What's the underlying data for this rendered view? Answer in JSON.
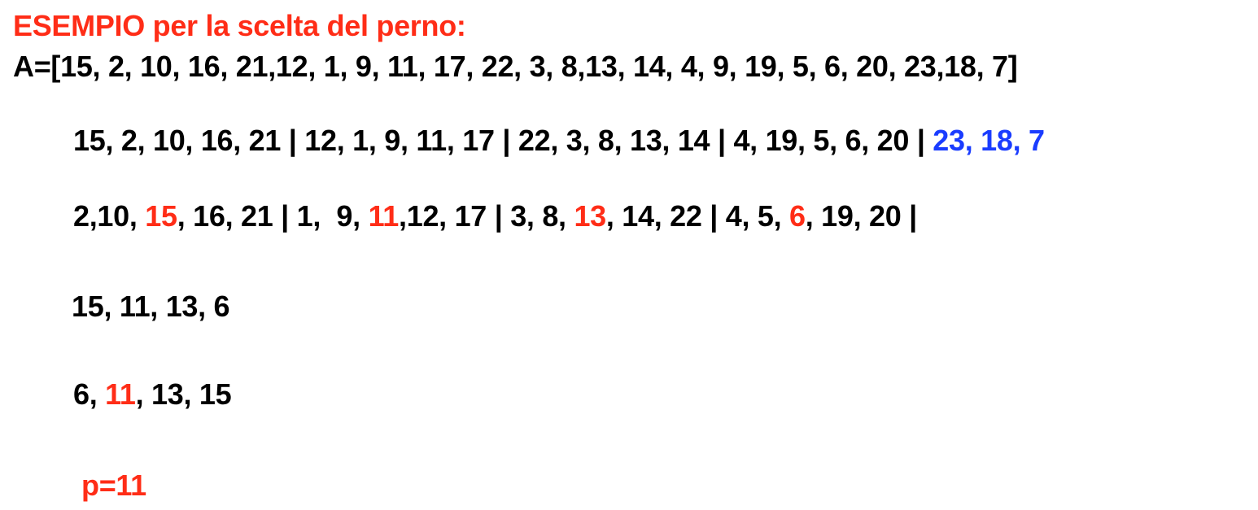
{
  "colors": {
    "red": "#ff2d17",
    "blue": "#1a3cff",
    "black": "#000000"
  },
  "title": "ESEMPIO per la scelta del perno:",
  "array_line": "A=[15, 2, 10, 16, 21,12, 1, 9, 11, 17, 22, 3, 8,13, 14, 4, 9, 19, 5, 6, 20, 23,18, 7]",
  "groups": {
    "g1": "15, 2, 10, 16, 21 | ",
    "g2": "12, 1, 9, 11, 17 | ",
    "g3": "22, 3, 8, 13, 14 | ",
    "g4": "4, 19, 5, 6, 20 | ",
    "g5": "23, 18, 7"
  },
  "sorted_groups": {
    "s1_pre": "2,10, ",
    "s1_med": "15",
    "s1_post": ", 16, 21 | 1,  9, ",
    "s2_med": "11",
    "s2_post": ",12, 17 | 3, 8, ",
    "s3_med": "13",
    "s3_post": ", 14, 22 | 4, 5, ",
    "s4_med": "6",
    "s4_post": ", 19, 20 |"
  },
  "medians_line": "15, 11, 13, 6",
  "medians_sorted": {
    "pre": "6, ",
    "med": "11",
    "post": ", 13, 15"
  },
  "pivot_line": "p=11"
}
